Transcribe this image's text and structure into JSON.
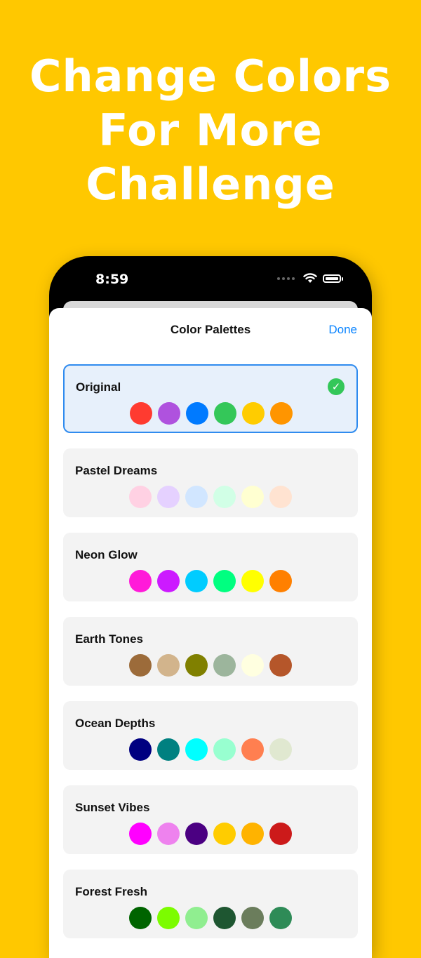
{
  "headline": [
    "Change Colors",
    "For More",
    "Challenge"
  ],
  "status_bar": {
    "time": "8:59"
  },
  "sheet": {
    "title": "Color Palettes",
    "done_label": "Done"
  },
  "accent_color": "#0A84FF",
  "palettes": [
    {
      "name": "Original",
      "selected": true,
      "colors": [
        "#FF3B30",
        "#AF52DE",
        "#007AFF",
        "#34C759",
        "#FFCC00",
        "#FF9500"
      ]
    },
    {
      "name": "Pastel Dreams",
      "selected": false,
      "colors": [
        "#FFD1E3",
        "#E5D1FF",
        "#D1E6FF",
        "#D1FFE6",
        "#FFFFD1",
        "#FFE3D1"
      ]
    },
    {
      "name": "Neon Glow",
      "selected": false,
      "colors": [
        "#FF1AD9",
        "#CC1AFF",
        "#00CCFF",
        "#00FF80",
        "#FFFF00",
        "#FF8000"
      ]
    },
    {
      "name": "Earth Tones",
      "selected": false,
      "colors": [
        "#9C6B3A",
        "#D2B48C",
        "#808000",
        "#9CB59C",
        "#FFFFE0",
        "#B5562A"
      ]
    },
    {
      "name": "Ocean Depths",
      "selected": false,
      "colors": [
        "#000080",
        "#008080",
        "#00FFFF",
        "#98FFD0",
        "#FF7F50",
        "#E0E8D0"
      ]
    },
    {
      "name": "Sunset Vibes",
      "selected": false,
      "colors": [
        "#FF00FF",
        "#EE82EE",
        "#4B0082",
        "#FFCC00",
        "#FFB300",
        "#CC1A1A"
      ]
    },
    {
      "name": "Forest Fresh",
      "selected": false,
      "colors": [
        "#006400",
        "#7CFC00",
        "#90EE90",
        "#1E5631",
        "#6B7D5C",
        "#2E8B57"
      ]
    }
  ]
}
